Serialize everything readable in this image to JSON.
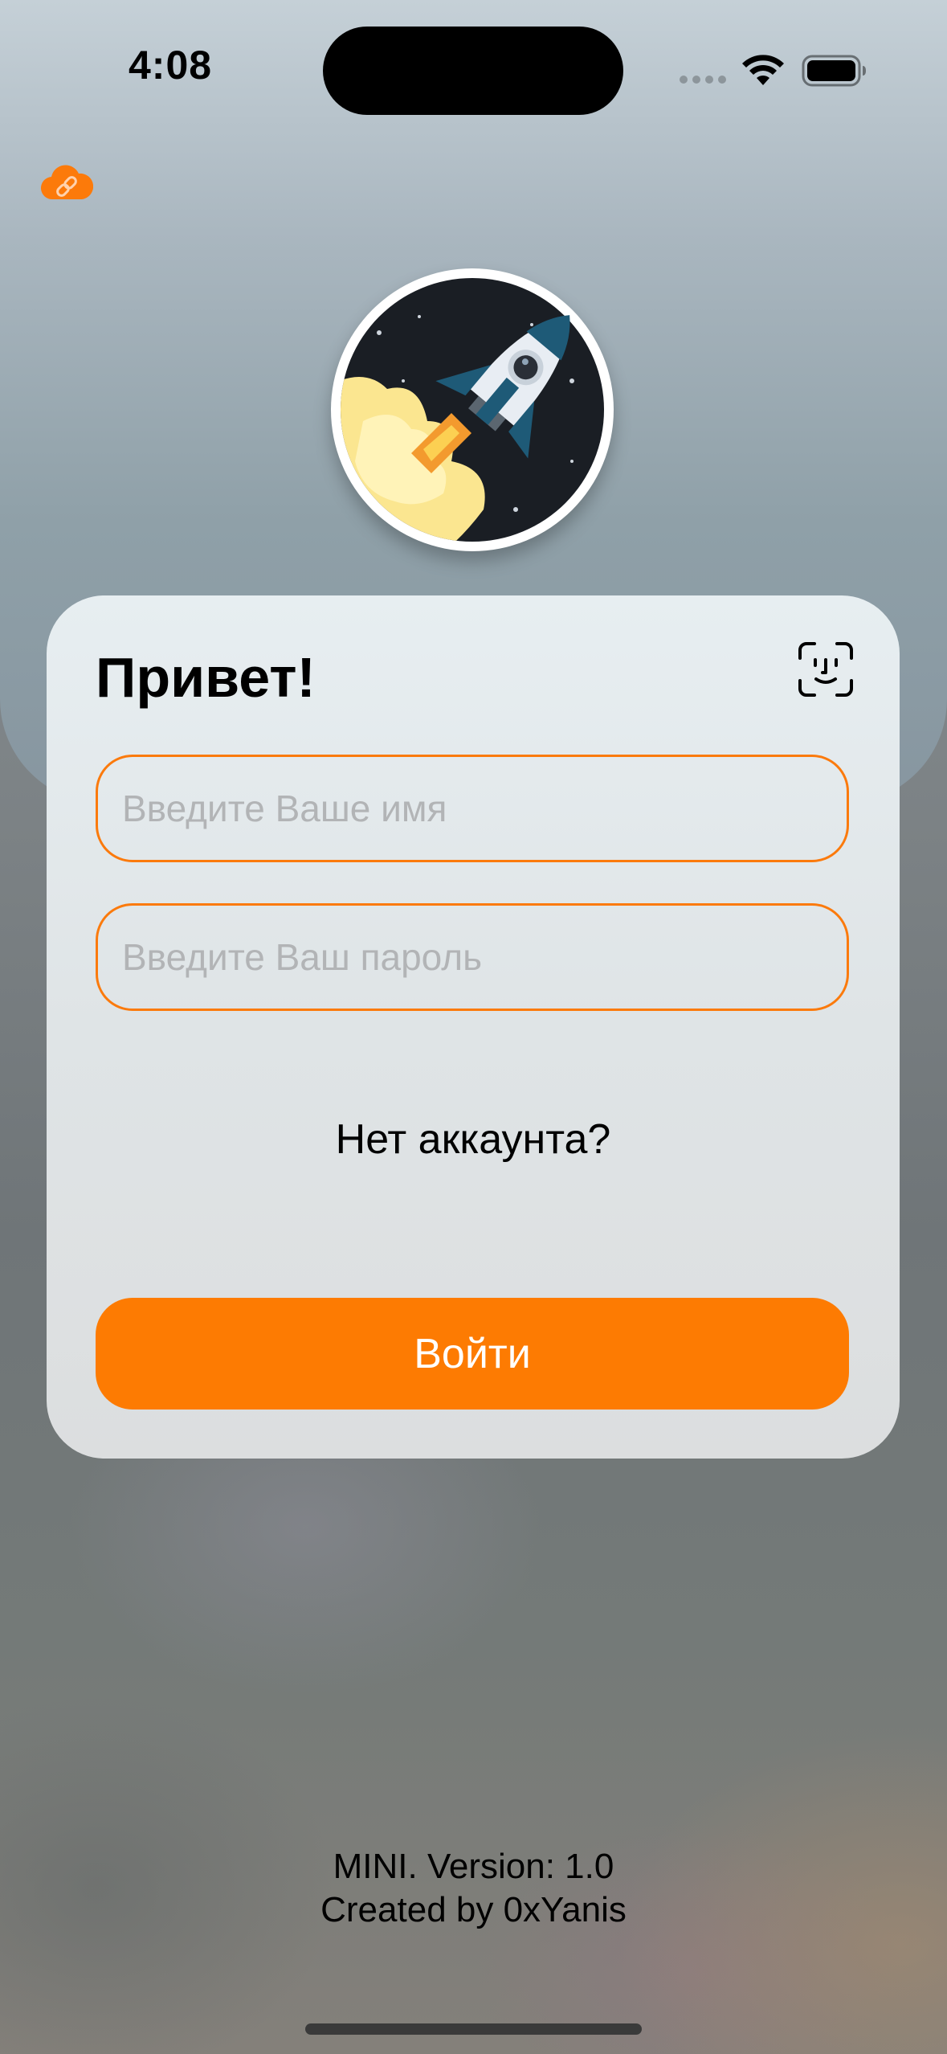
{
  "status_bar": {
    "time": "4:08"
  },
  "login_card": {
    "title": "Привет!",
    "name_placeholder": "Введите Ваше имя",
    "password_placeholder": "Введите Ваш пароль",
    "no_account_link": "Нет аккаунта?",
    "login_button": "Войти"
  },
  "footer": {
    "version": "MINI. Version: 1.0",
    "credit": "Created by 0xYanis"
  },
  "icons": {
    "top_left": "cloud-link-icon",
    "logo": "rocket-logo",
    "face_id": "face-id-icon"
  },
  "colors": {
    "accent": "#fd7b02",
    "field_border": "#fb7a0c"
  }
}
